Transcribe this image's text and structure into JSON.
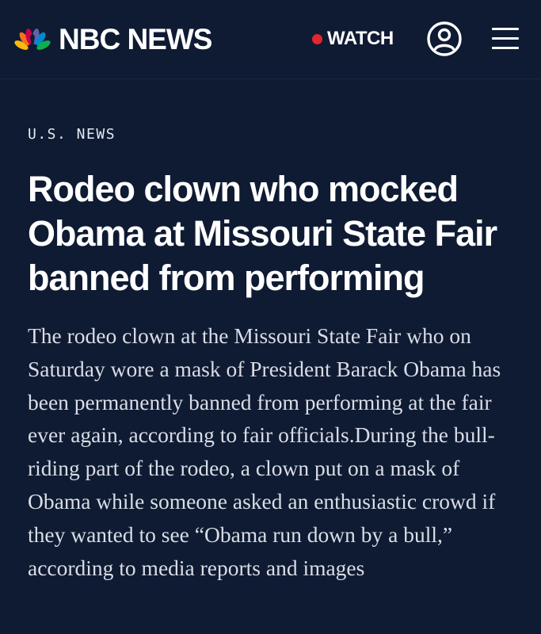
{
  "header": {
    "brand_name": "NBC NEWS",
    "logo_icon": "nbc-peacock-icon",
    "watch_label": "WATCH",
    "live_dot_color": "#e2262f",
    "user_icon": "user-icon",
    "menu_icon": "hamburger-menu-icon"
  },
  "article": {
    "section": "U.S. NEWS",
    "headline": "Rodeo clown who mocked Obama at Missouri State Fair banned from performing",
    "body": "The rodeo clown at the Missouri State Fair who on Saturday wore a mask of President Barack Obama has been permanently banned from performing at the fair ever again, according to fair officials.During the bull-riding part of the rodeo, a clown put on a mask of Obama while someone asked an enthusiastic crowd if they wanted to see “Obama run down by a bull,” according to media reports and images"
  },
  "colors": {
    "background": "#0f1b33",
    "text": "#ffffff",
    "body_text": "#d9dde5"
  }
}
